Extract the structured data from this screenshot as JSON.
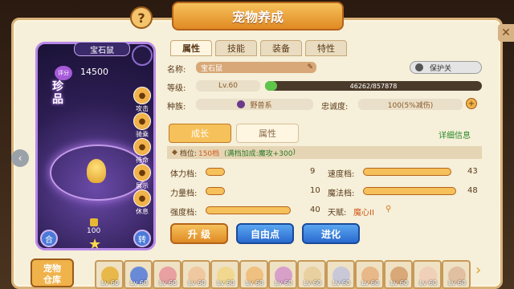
{
  "window": {
    "title": "宠物养成",
    "help": "?",
    "close": "✕",
    "left_arrow": "‹"
  },
  "pet": {
    "name": "宝石鼠",
    "score_label": "评分",
    "score": "14500",
    "rarity": "珍\n品",
    "level_display": "100"
  },
  "side_buttons": [
    "攻击",
    "骑乘",
    "待命",
    "展示",
    "休息"
  ],
  "card_buttons": {
    "left": "合",
    "right": "转"
  },
  "tabs": [
    "属性",
    "技能",
    "装备",
    "特性"
  ],
  "info": {
    "name_label": "名称:",
    "name_value": "宝石鼠",
    "level_label": "等级:",
    "level_value": "Lv.60",
    "exp_text": "46262/857878",
    "exp_progress": 0.054,
    "race_label": "种族:",
    "race_value": "野兽系",
    "loyalty_label": "忠诚度:",
    "loyalty_value": "100(5%减伤)",
    "protect_label": "保护关"
  },
  "subtabs": {
    "growth": "成长",
    "attr": "属性"
  },
  "detail_link": "详细信息",
  "grade": {
    "label": "档位:",
    "value": "150档",
    "bonus_prefix": "(满档加成:",
    "bonus_value": "魔攻+300",
    ")": ")"
  },
  "grades_left": [
    {
      "label": "体力档:",
      "value": "9",
      "fill": 0.09
    },
    {
      "label": "力量档:",
      "value": "10",
      "fill": 0.1
    },
    {
      "label": "强度档:",
      "value": "40",
      "fill": 0.9
    }
  ],
  "grades_right": [
    {
      "label": "速度档:",
      "value": "43",
      "fill": 0.88
    },
    {
      "label": "魔法档:",
      "value": "48",
      "fill": 0.96
    }
  ],
  "talent": {
    "label": "天赋:",
    "value": "魔心II"
  },
  "buttons": {
    "upgrade": "升 级",
    "free_points": "自由点",
    "evolve": "进化"
  },
  "warehouse": "宠物\n仓库",
  "slots": [
    {
      "lv": "Lv 60",
      "color": "#e8b84a"
    },
    {
      "lv": "Lv 60",
      "color": "#6a8ad8"
    },
    {
      "lv": "Lv 60",
      "color": "#e8a0a0"
    },
    {
      "lv": "Lv 60",
      "color": "#f0c8a0"
    },
    {
      "lv": "Lv 60",
      "color": "#f0d890"
    },
    {
      "lv": "Lv 60",
      "color": "#f0c080"
    },
    {
      "lv": "Lv 60",
      "color": "#d8a0c8"
    },
    {
      "lv": "Lv 60",
      "color": "#e8d0a0"
    },
    {
      "lv": "Lv 60",
      "color": "#c8c8d8"
    },
    {
      "lv": "Lv 60",
      "color": "#e8b888"
    },
    {
      "lv": "Lv 60",
      "color": "#d8a878"
    },
    {
      "lv": "Lv 60",
      "color": "#f0d0b8"
    },
    {
      "lv": "Lv 60",
      "color": "#e0c0a0"
    }
  ],
  "nav_next": "›"
}
